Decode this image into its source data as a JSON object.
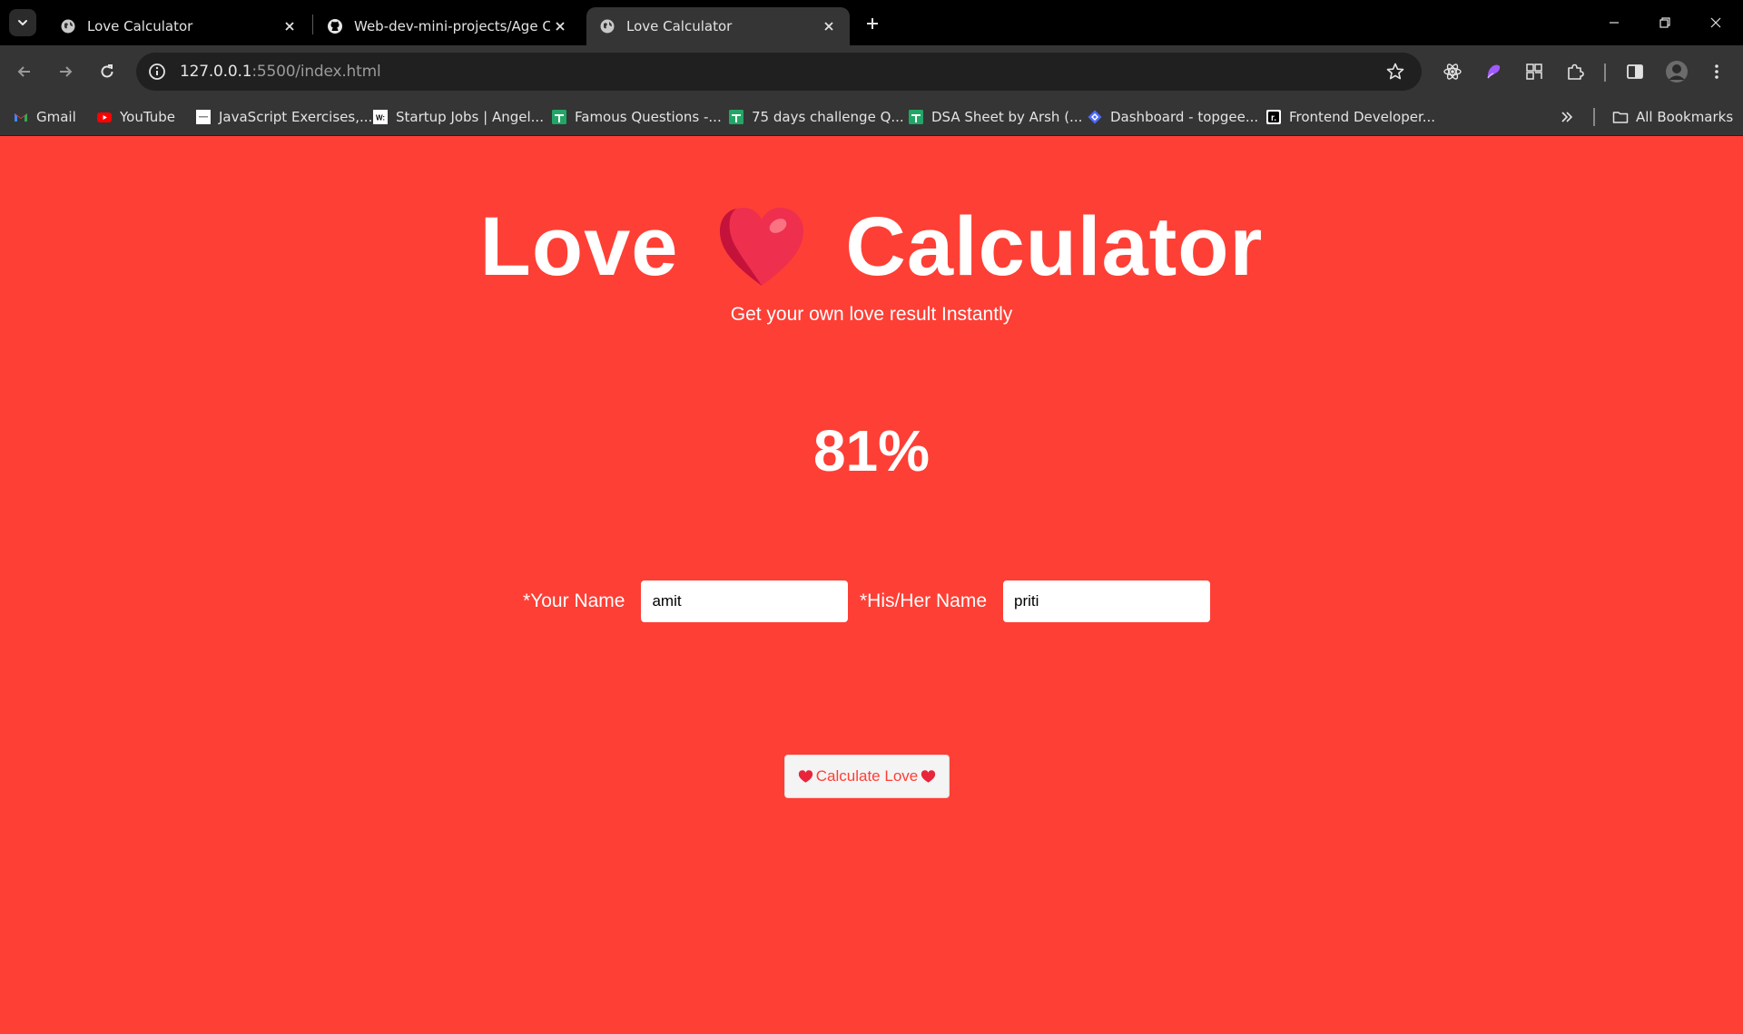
{
  "browser": {
    "tabs": [
      {
        "title": "Love Calculator",
        "icon": "globe-icon",
        "active": false
      },
      {
        "title": "Web-dev-mini-projects/Age Ca",
        "icon": "github-icon",
        "active": false
      },
      {
        "title": "Love Calculator",
        "icon": "globe-icon",
        "active": true
      }
    ],
    "address": {
      "host": "127.0.0.1",
      "path": ":5500/index.html"
    },
    "bookmarks": [
      {
        "label": "Gmail",
        "icon": "gmail-icon",
        "color": "#ea4335"
      },
      {
        "label": "YouTube",
        "icon": "youtube-icon",
        "color": "#ff0000"
      },
      {
        "label": "JavaScript Exercises,...",
        "icon": "page-icon",
        "color": "#ffffff"
      },
      {
        "label": "Startup Jobs | Angel...",
        "icon": "wellfound-icon",
        "color": "#ffffff"
      },
      {
        "label": "Famous Questions -...",
        "icon": "sheets-icon",
        "color": "#23a566"
      },
      {
        "label": "75 days challenge Q...",
        "icon": "sheets-icon",
        "color": "#23a566"
      },
      {
        "label": "DSA Sheet by Arsh (...",
        "icon": "sheets-icon",
        "color": "#23a566"
      },
      {
        "label": "Dashboard - topgee...",
        "icon": "topgeek-icon",
        "color": "#4d6bfe"
      },
      {
        "label": "Frontend Developer...",
        "icon": "r-icon",
        "color": "#000000"
      }
    ],
    "all_bookmarks": "All Bookmarks"
  },
  "app": {
    "title_left": "Love",
    "title_right": "Calculator",
    "subtitle": "Get your own love result Instantly",
    "result": "81%",
    "your_name_label": "*Your Name",
    "your_name_value": "amit",
    "their_name_label": "*His/Her Name",
    "their_name_value": "priti",
    "button_label": "Calculate Love"
  },
  "colors": {
    "page_bg": "#fe3f35",
    "heart": "#ee2f4e",
    "chrome_dark": "#000000",
    "chrome_toolbar": "#353535"
  }
}
